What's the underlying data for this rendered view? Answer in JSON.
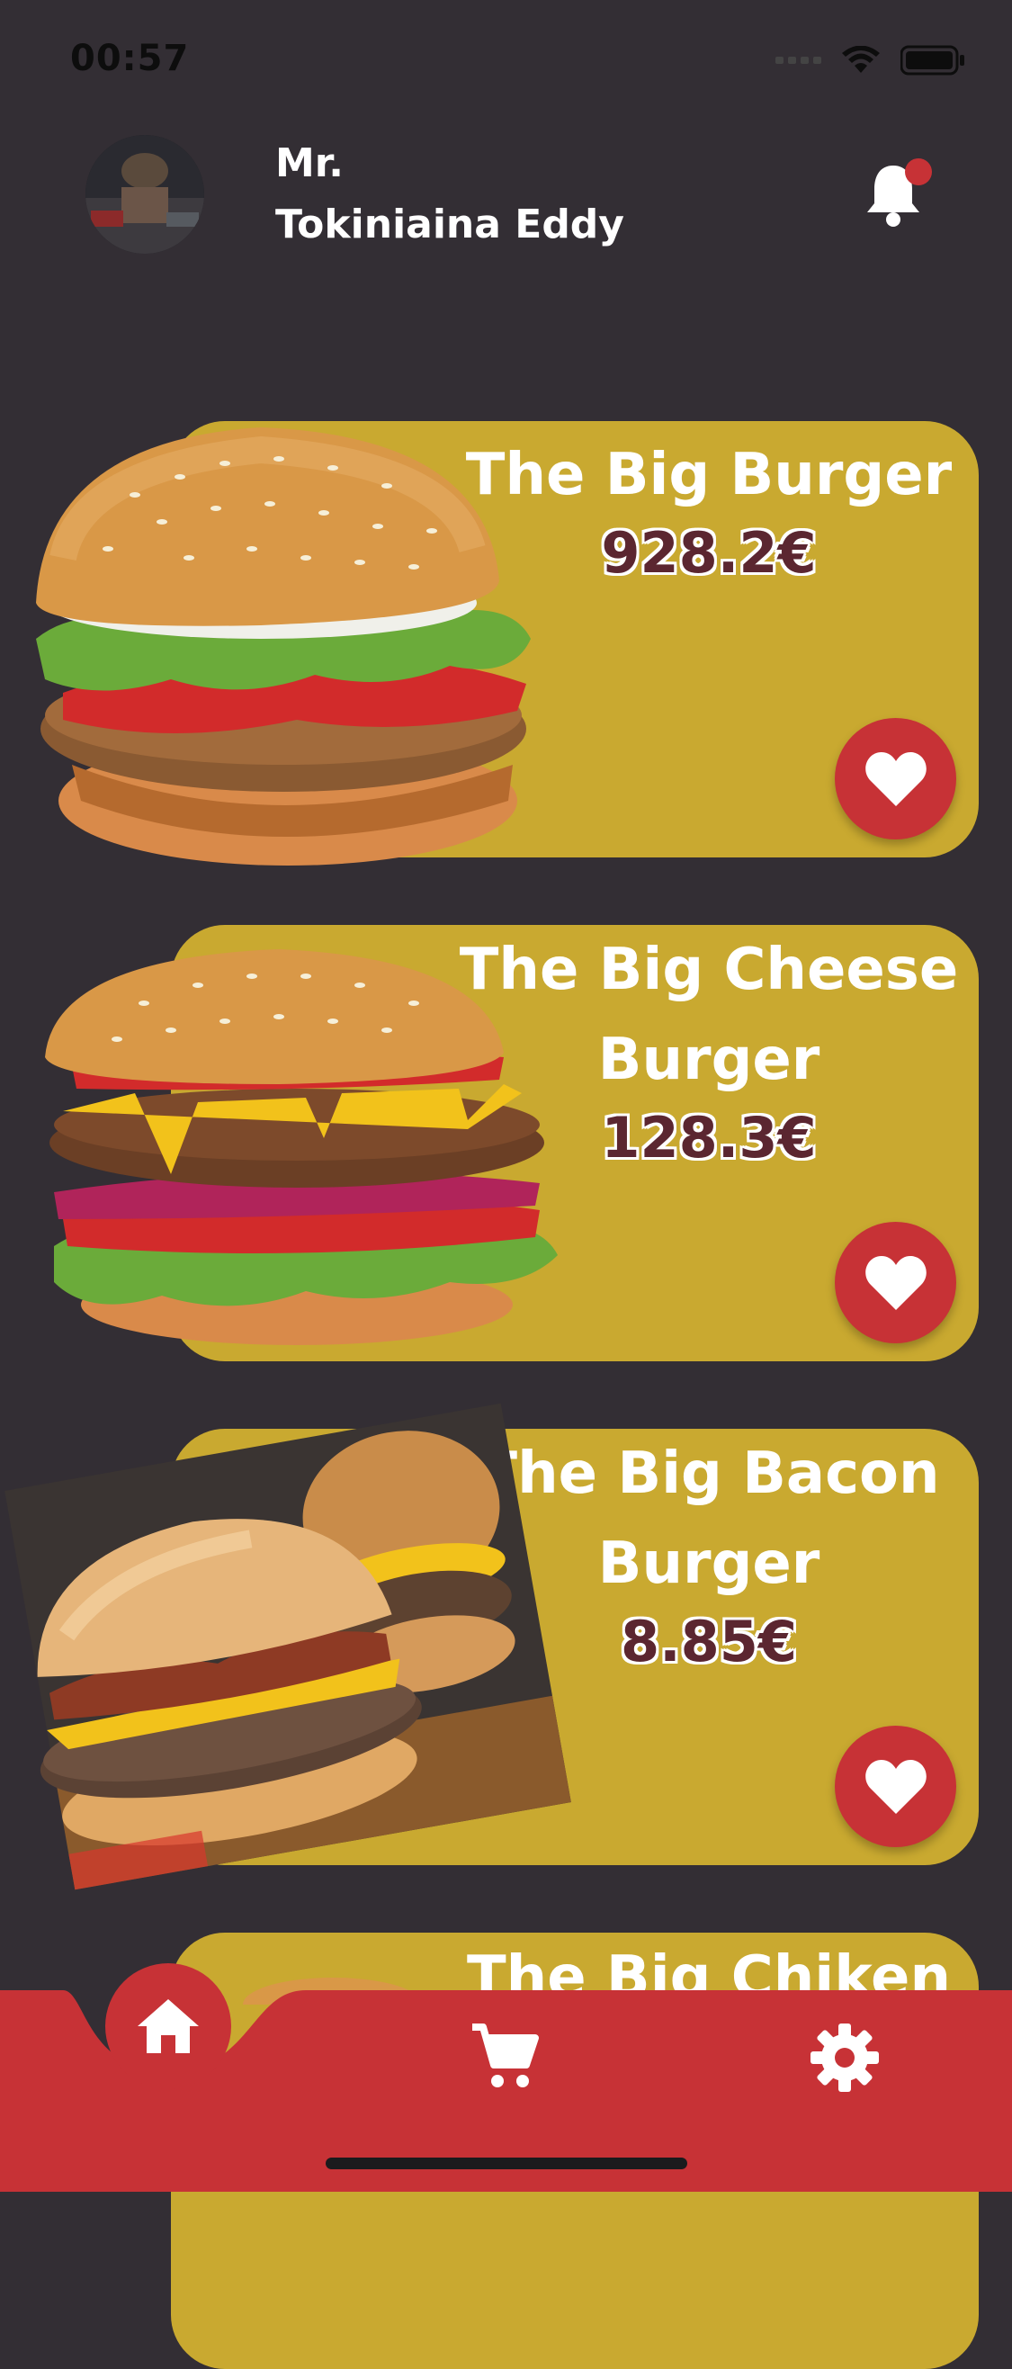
{
  "status_bar": {
    "time": "00:57"
  },
  "header": {
    "title": "Mr.",
    "name": "Tokiniaina Eddy",
    "notification_icon": "bell-icon"
  },
  "products": [
    {
      "title": "The Big Burger",
      "price": "928.2€",
      "image": "burger-image",
      "favorite_icon": "heart-icon"
    },
    {
      "title": "The Big Cheese Burger",
      "price": "128.3€",
      "image": "cheese-burger-image",
      "favorite_icon": "heart-icon"
    },
    {
      "title": "The Big Bacon Burger",
      "price": "8.85€",
      "image": "bacon-burger-image",
      "favorite_icon": "heart-icon"
    },
    {
      "title": "The Big Chiken",
      "price": "",
      "image": "chicken-burger-image",
      "favorite_icon": "heart-icon"
    }
  ],
  "bottom_nav": {
    "items": [
      {
        "icon": "home-icon",
        "active": true
      },
      {
        "icon": "cart-icon",
        "active": false
      },
      {
        "icon": "gear-icon",
        "active": false
      }
    ]
  },
  "colors": {
    "background": "#332e34",
    "card": "#c9a930",
    "accent": "#c73236",
    "price_text": "#5b2630"
  }
}
